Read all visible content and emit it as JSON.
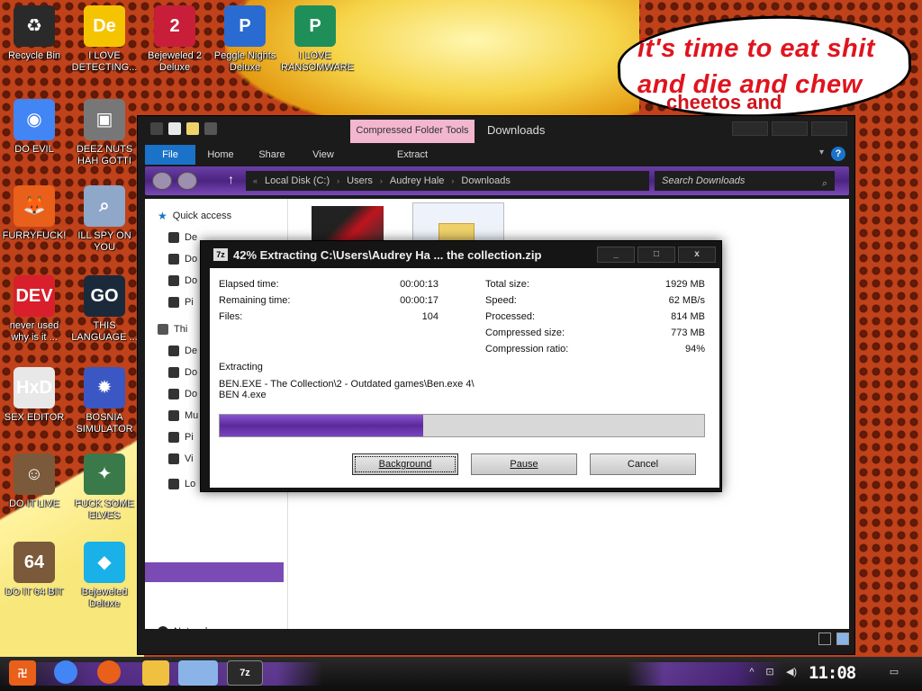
{
  "desktop": {
    "bubble_line1": "it's time to eat shit",
    "bubble_line2": "and die and chew",
    "bubble_line3": "cheetos and",
    "icons": [
      {
        "label": "Recycle Bin",
        "color": "#2a2a2a",
        "glyph": "♻"
      },
      {
        "label": "I LOVE DETECTING...",
        "color": "#f5c400",
        "glyph": "De"
      },
      {
        "label": "Bejeweled 2 Deluxe",
        "color": "#c81e3a",
        "glyph": "2"
      },
      {
        "label": "Peggle Nights Deluxe",
        "color": "#2a6bd1",
        "glyph": "P"
      },
      {
        "label": "I LOVE RANSOMWARE",
        "color": "#1f8f5a",
        "glyph": "P"
      },
      {
        "label": "DO EVIL",
        "color": "#4285f4",
        "glyph": "◉"
      },
      {
        "label": "DEEZ NUTS HAH GOTTI",
        "color": "#777777",
        "glyph": "▣"
      },
      {
        "label": "FURRYFUCK!",
        "color": "#e8601a",
        "glyph": "🦊"
      },
      {
        "label": "ILL SPY ON YOU",
        "color": "#8fa7c9",
        "glyph": "⌕"
      },
      {
        "label": "never used why is it ...",
        "color": "#d81f2b",
        "glyph": "DEV"
      },
      {
        "label": "THIS LANGUAGE ...",
        "color": "#1a2a3a",
        "glyph": "GO"
      },
      {
        "label": "SEX EDITOR",
        "color": "#e8e8e8",
        "glyph": "HxD"
      },
      {
        "label": "BOSNIA SIMULATOR",
        "color": "#3b57c4",
        "glyph": "✹"
      },
      {
        "label": "DO IT LIVE",
        "color": "#7a5a3a",
        "glyph": "☺"
      },
      {
        "label": "FUCK SOME ELVES",
        "color": "#3a7a4a",
        "glyph": "✦"
      },
      {
        "label": "DO IT 64 BIT",
        "color": "#7a5a3a",
        "glyph": "64"
      },
      {
        "label": "Bejeweled Deluxe",
        "color": "#1ab0e8",
        "glyph": "◆"
      }
    ]
  },
  "explorer": {
    "context_tab": "Compressed Folder Tools",
    "title": "Downloads",
    "ribbon_tabs": [
      "File",
      "Home",
      "Share",
      "View"
    ],
    "extract_tab": "Extract",
    "breadcrumb": [
      "Local Disk (C:)",
      "Users",
      "Audrey Hale",
      "Downloads"
    ],
    "search_placeholder": "Search Downloads",
    "nav": {
      "quick_access": "Quick access",
      "qa_items": [
        "De",
        "Do",
        "Do",
        "Pi"
      ],
      "this_pc": "Thi",
      "pc_items": [
        "De",
        "Do",
        "Do",
        "Mu",
        "Pi",
        "Vi",
        "Lo"
      ],
      "network": "Network"
    }
  },
  "dialog": {
    "title": "42% Extracting C:\\Users\\Audrey Ha ... the collection.zip",
    "app_icon": "7z",
    "win_buttons": {
      "min": "_",
      "max": "□",
      "close": "x"
    },
    "stats_left": [
      {
        "label": "Elapsed time:",
        "value": "00:00:13"
      },
      {
        "label": "Remaining time:",
        "value": "00:00:17"
      },
      {
        "label": "Files:",
        "value": "104"
      }
    ],
    "stats_right": [
      {
        "label": "Total size:",
        "value": "1929 MB"
      },
      {
        "label": "Speed:",
        "value": "62 MB/s"
      },
      {
        "label": "Processed:",
        "value": "814 MB"
      },
      {
        "label": "Compressed size:",
        "value": "773 MB"
      },
      {
        "label": "Compression ratio:",
        "value": "94%"
      }
    ],
    "operation": "Extracting",
    "current_path_line1": "BEN.EXE - The Collection\\2 - Outdated games\\Ben.exe 4\\",
    "current_path_line2": "BEN 4.exe",
    "progress_percent": 42,
    "buttons": {
      "background": "Background",
      "pause": "Pause",
      "cancel": "Cancel"
    },
    "accent_color": "#6a35b0"
  },
  "taskbar": {
    "clock": "11:08 AM",
    "items": [
      "start",
      "chrome",
      "firefox",
      "file-explorer",
      "notepad",
      "7-zip"
    ],
    "zip_label": "7z"
  }
}
